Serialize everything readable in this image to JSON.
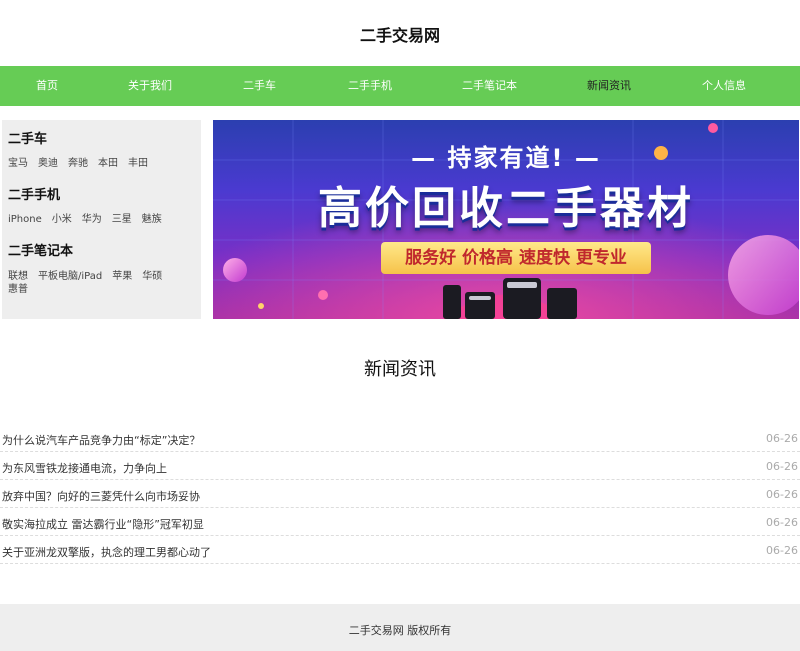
{
  "site": {
    "title": "二手交易网"
  },
  "nav": {
    "items": [
      {
        "label": "首页"
      },
      {
        "label": "关于我们"
      },
      {
        "label": "二手车"
      },
      {
        "label": "二手手机"
      },
      {
        "label": "二手笔记本"
      },
      {
        "label": "新闻资讯"
      },
      {
        "label": "个人信息"
      }
    ],
    "active_label": "新闻资讯",
    "color": "#66cc55"
  },
  "sidebar": {
    "categories": [
      {
        "title": "二手车",
        "links": [
          "宝马",
          "奥迪",
          "奔驰",
          "本田",
          "丰田"
        ]
      },
      {
        "title": "二手手机",
        "links": [
          "iPhone",
          "小米",
          "华为",
          "三星",
          "魅族"
        ]
      },
      {
        "title": "二手笔记本",
        "links": [
          "联想",
          "平板电脑/iPad",
          "苹果",
          "华硕",
          "惠普"
        ]
      }
    ]
  },
  "banner": {
    "slogan": "— 持家有道! —",
    "headline": "高价回收二手器材",
    "tags": "服务好  价格高  速度快  更专业"
  },
  "news": {
    "heading": "新闻资讯",
    "items": [
      {
        "title": "为什么说汽车产品竞争力由“标定”决定？",
        "date": "06-26"
      },
      {
        "title": "为东风雪铁龙接通电流，力争向上",
        "date": "06-26"
      },
      {
        "title": "放弃中国？向好的三菱凭什么向市场妥协",
        "date": "06-26"
      },
      {
        "title": "敬实海拉成立 雷达霸行业“隐形”冠军初显",
        "date": "06-26"
      },
      {
        "title": "关于亚洲龙双擎版，执念的理工男都心动了",
        "date": "06-26"
      }
    ]
  },
  "footer": {
    "text": "二手交易网 版权所有"
  }
}
